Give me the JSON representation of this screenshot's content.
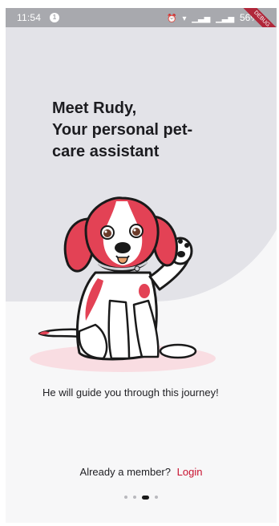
{
  "status_bar": {
    "time": "11:54",
    "notification_badge": "1",
    "battery_text": "56%",
    "icons": [
      "alarm-icon",
      "wifi-icon",
      "signal-icon",
      "signal-icon",
      "battery-icon"
    ]
  },
  "debug_banner": "DEBUG",
  "headline": {
    "line1": "Meet Rudy,",
    "line2": "Your personal pet-",
    "line3": "care assistant"
  },
  "subtitle": "He will guide you through this journey!",
  "login": {
    "prompt": "Already a member?",
    "link": "Login"
  },
  "pagination": {
    "total": 4,
    "active_index": 2
  },
  "colors": {
    "accent": "#c8102e",
    "background_blob": "#e3e3e8",
    "status_bar": "#a8a9ae"
  }
}
